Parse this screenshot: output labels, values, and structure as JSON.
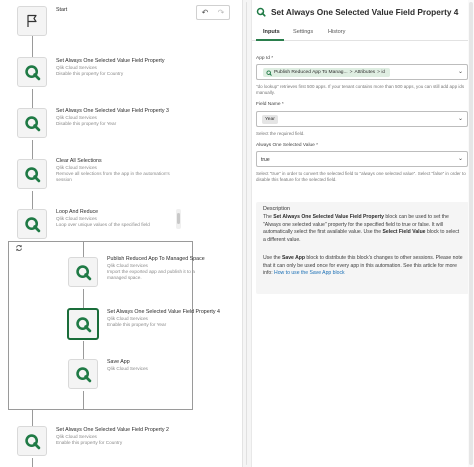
{
  "canvas": {
    "start_label": "Start",
    "blocks": [
      {
        "title": "Set Always One Selected Value Field Property",
        "provider": "Qlik Cloud Services",
        "desc": "Disable this property for Country"
      },
      {
        "title": "Set Always One Selected Value Field Property 3",
        "provider": "Qlik Cloud Services",
        "desc": "Disable this property for Year"
      },
      {
        "title": "Clear All Selections",
        "provider": "Qlik Cloud Services",
        "desc": "Remove all selections from the app in the automation's session"
      },
      {
        "title": "Loop And Reduce",
        "provider": "Qlik Cloud Services",
        "desc": "Loop over unique values of the specified field"
      },
      {
        "title": "Publish Reduced App To Managed Space",
        "provider": "Qlik Cloud Services",
        "desc": "Import the exported app and publish it to a managed space."
      },
      {
        "title": "Set Always One Selected Value Field Property 4",
        "provider": "Qlik Cloud Services",
        "desc": "Enable this property for Year"
      },
      {
        "title": "Save App",
        "provider": "Qlik Cloud Services",
        "desc": ""
      },
      {
        "title": "Set Always One Selected Value Field Property 2",
        "provider": "Qlik Cloud Services",
        "desc": "Enable this property for Country"
      }
    ],
    "undo_icon": "undo-icon",
    "redo_icon": "redo-icon"
  },
  "panel": {
    "title": "Set Always One Selected Value Field Property 4",
    "tabs": [
      {
        "label": "Inputs",
        "active": true
      },
      {
        "label": "Settings",
        "active": false
      },
      {
        "label": "History",
        "active": false
      }
    ],
    "app_id": {
      "label": "App Id *",
      "chip_main": "Publish Reduced App To Manag...",
      "chip_sep": ">",
      "chip_attr": "Attributes",
      "chip_attr2": "> id",
      "help": "\"do lookup\" retrieves first 500 apps. If your tenant contains more than 500 apps, you can still add app ids manually."
    },
    "field_name": {
      "label": "Field Name *",
      "value": "Year",
      "help": "Select the required field."
    },
    "always_one": {
      "label": "Always One Selected Value *",
      "value": "true",
      "help": "Select \"true\" in order to convert the selected field to \"always one selected value\". Select \"false\" in order to disable this feature for the selected field."
    },
    "description": {
      "title": "Description",
      "p1_pre": "The ",
      "p1_b1": "Set Always One Selected Value Field Property",
      "p1_mid": " block can be used to set the \"Always one selected value\" property for the specified field to true or false. It will automatically select the first available value. Use the ",
      "p1_b2": "Select Field Value",
      "p1_post": " block to select a different value.",
      "p2_pre": "Use the ",
      "p2_b1": "Save App",
      "p2_mid": " block to distribute this block's changes to other sessions. Please note that it can only be used once for every app in this automation. See this article for more info: ",
      "p2_link": "How to use the Save App block"
    }
  },
  "colors": {
    "brand_green": "#2a7e4c",
    "selected_border": "#1a6d3a",
    "link": "#1a6fb5"
  }
}
